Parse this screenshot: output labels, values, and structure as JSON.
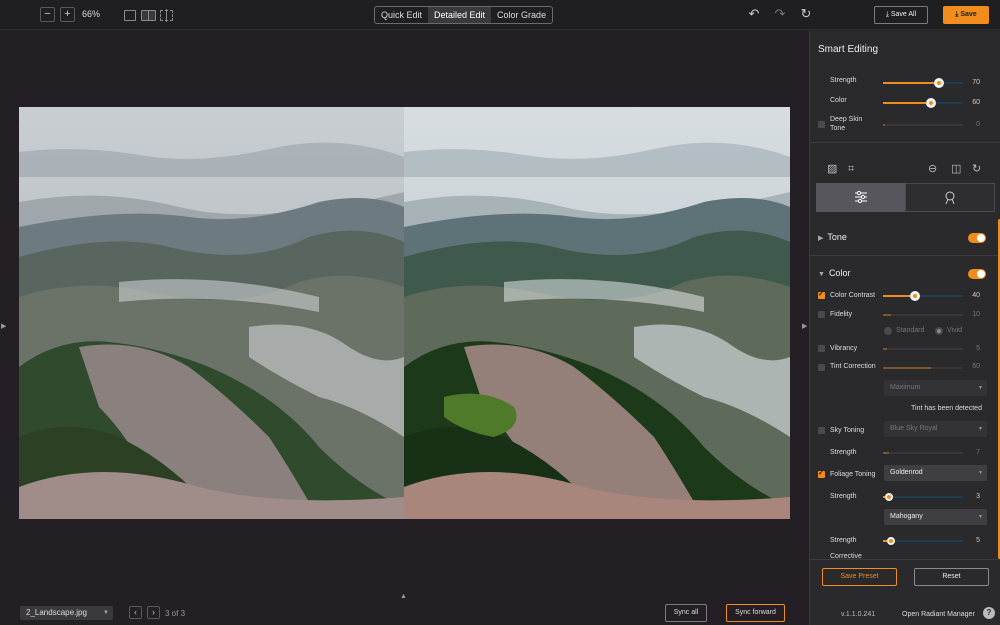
{
  "toolbar": {
    "zoom_out": "−",
    "zoom_in": "+",
    "zoom_level": "66%",
    "modes": [
      "Quick Edit",
      "Detailed Edit",
      "Color Grade"
    ],
    "active_mode": "Detailed Edit",
    "undo_icon": "↶",
    "redo_icon": "↷",
    "refresh_icon": "↻",
    "save_all": "⤓ Save All",
    "save": "⤓ Save"
  },
  "canvas": {
    "left_arrow": "▶",
    "right_arrow": "▶",
    "up_arrow": "▲"
  },
  "footer": {
    "filename": "2_Landscape.jpg",
    "prev": "‹",
    "next": "›",
    "page_count": "3 of 3",
    "sync_all": "Sync all",
    "sync_forward": "Sync forward"
  },
  "panel": {
    "title": "Smart Editing",
    "strength_label": "Strength",
    "strength_value": "70",
    "strength_level": 0.7,
    "color_label": "Color",
    "color_value": "60",
    "color_level": 0.6,
    "deep_skin_label_1": "Deep Skin",
    "deep_skin_label_2": "Tone",
    "deep_skin_value": "0",
    "tone_section": "Tone",
    "color_section": "Color",
    "color_contrast_label": "Color Contrast",
    "color_contrast_value": "40",
    "color_contrast_level": 0.4,
    "fidelity_label": "Fidelity",
    "fidelity_value": "10",
    "radio_standard": "Standard",
    "radio_vivid": "Vivid",
    "vibrancy_label": "Vibrancy",
    "vibrancy_value": "5",
    "tint_label": "Tint Correction",
    "tint_value": "60",
    "tint_dropdown": "Maximum",
    "tint_note": "Tint has been detected",
    "sky_label": "Sky Toning",
    "sky_dropdown": "Blue Sky Royal",
    "sky_strength_label": "Strength",
    "sky_strength_value": "7",
    "foliage_label": "Foliage Toning",
    "foliage_dropdown": "Goldenrod",
    "foliage_strength_label": "Strength",
    "foliage_strength_value": "3",
    "foliage_dropdown_2": "Mahogany",
    "foliage_strength_2_label": "Strength",
    "foliage_strength_2_value": "5",
    "corrective_label": "Corrective",
    "save_preset": "Save Preset",
    "reset": "Reset",
    "version": "v.1.1.0.241",
    "manager": "Open Radiant Manager",
    "help": "?"
  },
  "colors": {
    "accent": "#f08d1c",
    "background": "#231f24",
    "panel": "#2a292c"
  }
}
